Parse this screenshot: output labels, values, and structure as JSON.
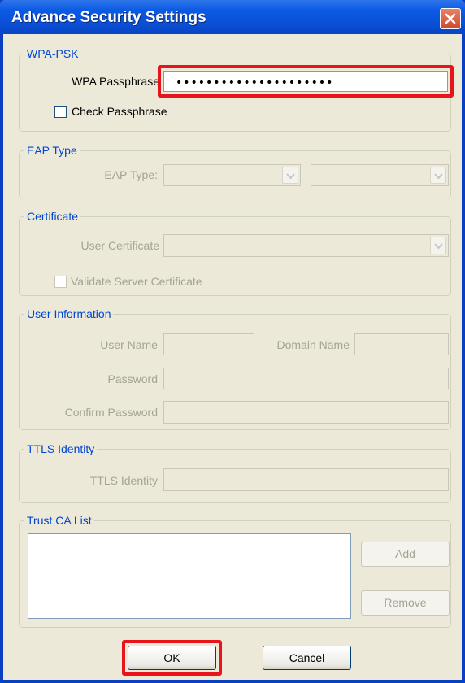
{
  "window": {
    "title": "Advance Security Settings"
  },
  "wpa_psk": {
    "legend": "WPA-PSK",
    "passphrase_label": "WPA Passphrase",
    "passphrase_value": "•••••••••••••••••••••",
    "check_label": "Check Passphrase"
  },
  "eap": {
    "legend": "EAP Type",
    "type_label": "EAP Type:"
  },
  "certificate": {
    "legend": "Certificate",
    "user_cert_label": "User Certificate",
    "validate_label": "Validate Server Certificate"
  },
  "user_info": {
    "legend": "User Information",
    "username_label": "User Name",
    "domain_label": "Domain Name",
    "password_label": "Password",
    "confirm_label": "Confirm Password"
  },
  "ttls": {
    "legend": "TTLS Identity",
    "identity_label": "TTLS Identity"
  },
  "trust_ca": {
    "legend": "Trust CA List",
    "add_label": "Add",
    "remove_label": "Remove"
  },
  "footer": {
    "ok_label": "OK",
    "cancel_label": "Cancel"
  },
  "colors": {
    "titlebar": "#0a4fd6",
    "dialog_bg": "#ece9d8",
    "legend_text": "#0046d5",
    "highlight": "#e8141b"
  }
}
